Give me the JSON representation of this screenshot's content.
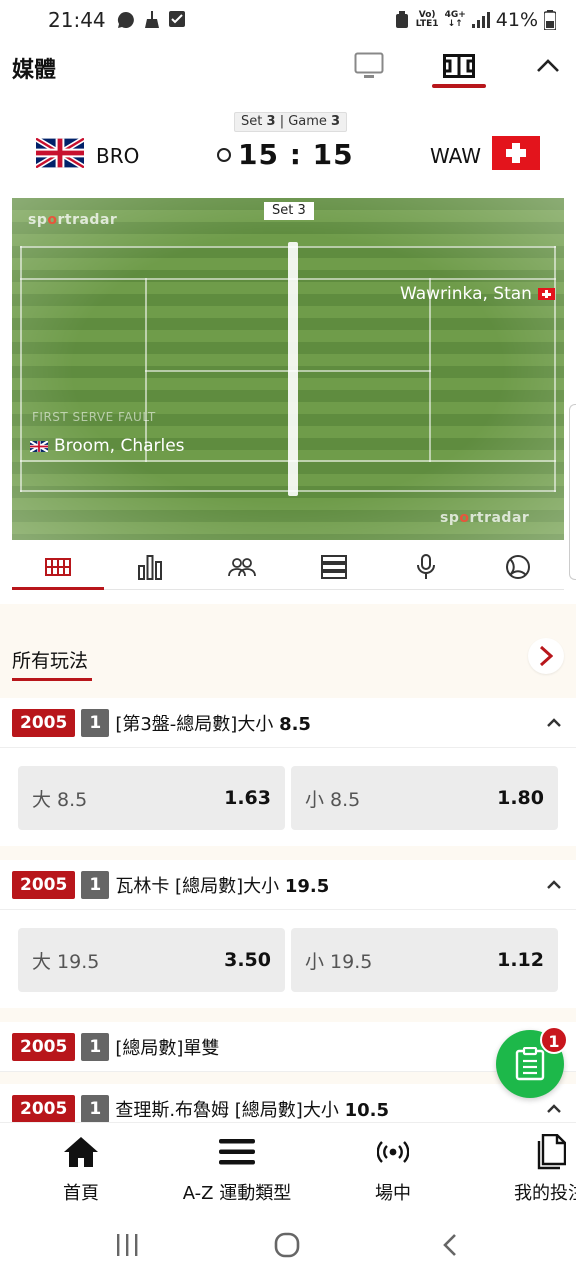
{
  "status_bar": {
    "time": "21:44",
    "network_top": "Vo)",
    "network_bottom": "LTE1",
    "signal_top": "4G+",
    "signal_bottom": "↓↑",
    "battery": "41%"
  },
  "media": {
    "title": "媒體"
  },
  "match": {
    "set_label": "Set",
    "set_num": "3",
    "sep": "| Game",
    "game_num": "3",
    "home": "BRO",
    "away": "WAW",
    "score": "15 : 15"
  },
  "court": {
    "brand_a": "sp",
    "brand_b": "o",
    "brand_c": "rtradar",
    "set_tag": "Set 3",
    "player_away": "Wawrinka, Stan",
    "player_home": "Broom, Charles",
    "event": "FIRST SERVE FAULT"
  },
  "markets": {
    "all_plays": "所有玩法",
    "items": [
      {
        "code": "2005",
        "num": "1",
        "title": "[第3盤-總局數]大小",
        "line": "8.5",
        "over_name": "大 8.5",
        "over_price": "1.63",
        "under_name": "小 8.5",
        "under_price": "1.80"
      },
      {
        "code": "2005",
        "num": "1",
        "title": "瓦林卡 [總局數]大小",
        "line": "19.5",
        "over_name": "大 19.5",
        "over_price": "3.50",
        "under_name": "小 19.5",
        "under_price": "1.12"
      },
      {
        "code": "2005",
        "num": "1",
        "title": "[總局數]單雙",
        "line": ""
      },
      {
        "code": "2005",
        "num": "1",
        "title": "查理斯.布魯姆 [總局數]大小",
        "line": "10.5"
      }
    ]
  },
  "betslip": {
    "count": "1"
  },
  "bottom_nav": {
    "home": "首頁",
    "sports": "A-Z 運動類型",
    "live": "場中",
    "my_bets": "我的投注"
  },
  "colors": {
    "brand_red": "#b8161b",
    "betslip_green": "#1db84a",
    "court_green": "#6f9c4a"
  }
}
